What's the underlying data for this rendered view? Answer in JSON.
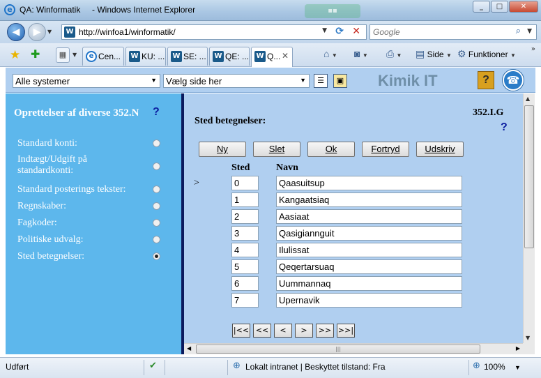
{
  "window": {
    "title": "QA: Winformatik     - Windows Internet Explorer"
  },
  "address": {
    "url": "http://winfoa1/winformatik/",
    "search_placeholder": "Google"
  },
  "tabs": [
    {
      "label": "Cen...",
      "icon": "ie-icon"
    },
    {
      "label": "KU: ...",
      "icon": "w-icon"
    },
    {
      "label": "SE: ...",
      "icon": "w-icon"
    },
    {
      "label": "QE: ...",
      "icon": "w-icon"
    },
    {
      "label": "Q...",
      "icon": "w-icon",
      "active": true
    }
  ],
  "commandbar": {
    "side": "Side",
    "funktioner": "Funktioner"
  },
  "app": {
    "system_select": "Alle systemer",
    "page_select": "Vælg side her",
    "brand": "Kimik IT"
  },
  "sidebar": {
    "title": "Oprettelser af diverse 352.N",
    "help": "?",
    "items": [
      {
        "label": "Standard konti:",
        "selected": false
      },
      {
        "label": "Indtægt/Udgift på standardkonti:",
        "selected": false
      },
      {
        "label": "Standard posterings tekster:",
        "selected": false
      },
      {
        "label": "Regnskaber:",
        "selected": false
      },
      {
        "label": "Fagkoder:",
        "selected": false
      },
      {
        "label": "Politiske udvalg:",
        "selected": false
      },
      {
        "label": "Sted betegnelser:",
        "selected": true
      }
    ]
  },
  "main": {
    "heading": "Sted betegnelser:",
    "code": "352.I.G",
    "help": "?",
    "buttons": {
      "ny": "Ny",
      "slet": "Slet",
      "ok": "Ok",
      "fortryd": "Fortryd",
      "udskriv": "Udskriv"
    },
    "columns": {
      "sted": "Sted",
      "navn": "Navn"
    },
    "current_row_marker": ">",
    "rows": [
      {
        "sted": "0",
        "navn": "Qaasuitsup"
      },
      {
        "sted": "1",
        "navn": "Kangaatsiaq"
      },
      {
        "sted": "2",
        "navn": "Aasiaat"
      },
      {
        "sted": "3",
        "navn": "Qasigiannguit"
      },
      {
        "sted": "4",
        "navn": "Ilulissat"
      },
      {
        "sted": "5",
        "navn": "Qeqertarsuaq"
      },
      {
        "sted": "6",
        "navn": "Uummannaq"
      },
      {
        "sted": "7",
        "navn": "Upernavik"
      }
    ],
    "pager": {
      "first": "|<<",
      "prev_page": "<<",
      "prev": "<",
      "next": ">",
      "next_page": ">>",
      "last": ">>|"
    }
  },
  "statusbar": {
    "status": "Udført",
    "zone": "Lokalt intranet | Beskyttet tilstand: Fra",
    "zoom": "100%"
  }
}
